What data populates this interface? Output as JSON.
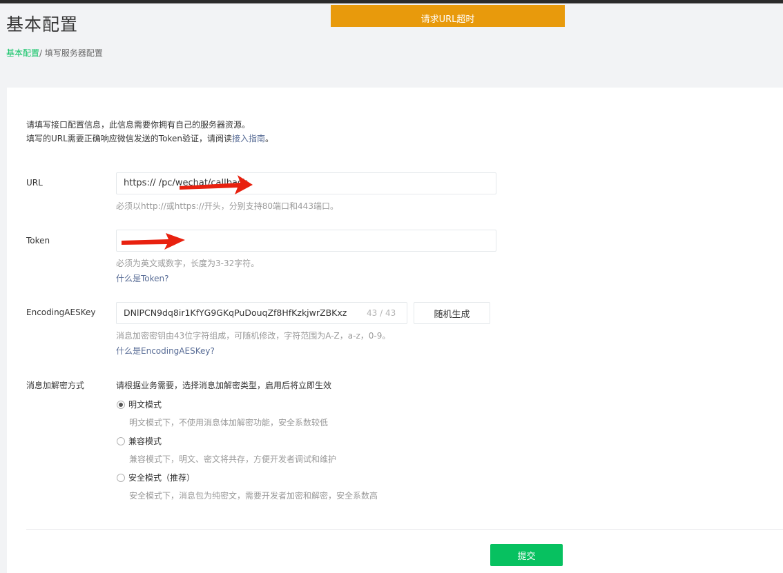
{
  "toast": {
    "text": "请求URL超时"
  },
  "header": {
    "title": "基本配置",
    "breadcrumb": {
      "link": "基本配置",
      "separator": "/",
      "current": " 填写服务器配置"
    }
  },
  "intro": {
    "line1": "请填写接口配置信息，此信息需要你拥有自己的服务器资源。",
    "line2_prefix": "填写的URL需要正确响应微信发送的Token验证，请阅读",
    "line2_link": "接入指南",
    "line2_suffix": "。"
  },
  "url": {
    "label": "URL",
    "value": "https://                      /pc/wechat/callback",
    "hint": "必须以http://或https://开头，分别支持80端口和443端口。"
  },
  "token": {
    "label": "Token",
    "value": "",
    "hint": "必须为英文或数字，长度为3-32字符。",
    "help_link": "什么是Token?"
  },
  "aes": {
    "label": "EncodingAESKey",
    "value": "DNlPCN9dq8ir1KfYG9GKqPuDouqZf8HfKzkjwrZBKxz",
    "counter": "43 / 43",
    "random_button": "随机生成",
    "hint": "消息加密密钥由43位字符组成，可随机修改，字符范围为A-Z，a-z，0-9。",
    "help_link": "什么是EncodingAESKey?"
  },
  "encryption": {
    "label": "消息加解密方式",
    "description": "请根据业务需要，选择消息加解密类型，启用后将立即生效",
    "options": [
      {
        "label": "明文模式",
        "desc": "明文模式下，不使用消息体加解密功能，安全系数较低",
        "checked": true
      },
      {
        "label": "兼容模式",
        "desc": "兼容模式下，明文、密文将共存，方便开发者调试和维护",
        "checked": false
      },
      {
        "label": "安全模式（推荐）",
        "desc": "安全模式下，消息包为纯密文，需要开发者加密和解密，安全系数高",
        "checked": false
      }
    ]
  },
  "submit": {
    "label": "提交"
  },
  "colors": {
    "primary": "#07c160",
    "link": "#576b95",
    "toast": "#e89a0c",
    "redaction": "#e8210f"
  }
}
